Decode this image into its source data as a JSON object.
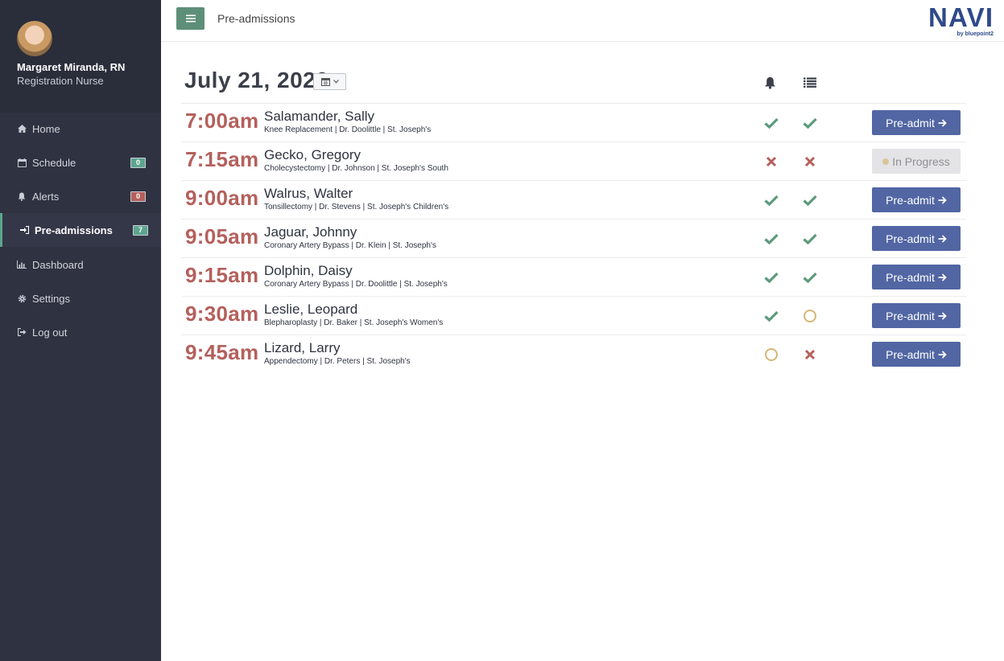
{
  "user": {
    "name": "Margaret Miranda, RN",
    "role": "Registration Nurse"
  },
  "nav": [
    {
      "label": "Home",
      "icon": "home-icon"
    },
    {
      "label": "Schedule",
      "icon": "calendar-icon",
      "badge": "0",
      "badge_color": "#5da58f"
    },
    {
      "label": "Alerts",
      "icon": "bell-icon",
      "badge": "0",
      "badge_color": "#b4605c"
    },
    {
      "label": "Pre-admissions",
      "icon": "sign-in-icon",
      "badge": "7",
      "badge_color": "#5da58f",
      "active": true
    },
    {
      "label": "Dashboard",
      "icon": "bar-chart-icon"
    },
    {
      "label": "Settings",
      "icon": "gear-icon"
    },
    {
      "label": "Log out",
      "icon": "log-out-icon"
    }
  ],
  "header": {
    "breadcrumb": "Pre-admissions",
    "logo_text": "NAVI",
    "logo_sub": "by bluepoint2"
  },
  "date": {
    "title": "July 21, 2020"
  },
  "colors": {
    "check": "#5d9a7c",
    "cross": "#b4605c",
    "pending": "#d6b676",
    "primary": "#5166a3",
    "time": "#b4605c"
  },
  "rows": [
    {
      "time": "7:00am",
      "name": "Salamander, Sally",
      "details": "Knee Replacement | Dr. Doolittle | St. Joseph's",
      "status1": "check",
      "status2": "check",
      "action": "Pre-admit",
      "action_state": "primary"
    },
    {
      "time": "7:15am",
      "name": "Gecko, Gregory",
      "details": "Cholecystectomy | Dr. Johnson | St. Joseph's South",
      "status1": "cross",
      "status2": "cross",
      "action": "In Progress",
      "action_state": "disabled"
    },
    {
      "time": "9:00am",
      "name": "Walrus, Walter",
      "details": "Tonsillectomy | Dr. Stevens | St. Joseph's Children's",
      "status1": "check",
      "status2": "check",
      "action": "Pre-admit",
      "action_state": "primary"
    },
    {
      "time": "9:05am",
      "name": "Jaguar, Johnny",
      "details": "Coronary Artery Bypass | Dr. Klein | St. Joseph's",
      "status1": "check",
      "status2": "check",
      "action": "Pre-admit",
      "action_state": "primary"
    },
    {
      "time": "9:15am",
      "name": "Dolphin, Daisy",
      "details": "Coronary Artery Bypass | Dr. Doolittle | St. Joseph's",
      "status1": "check",
      "status2": "check",
      "action": "Pre-admit",
      "action_state": "primary"
    },
    {
      "time": "9:30am",
      "name": "Leslie, Leopard",
      "details": "Blepharoplasty | Dr. Baker | St. Joseph's Women's",
      "status1": "check",
      "status2": "pending",
      "action": "Pre-admit",
      "action_state": "primary"
    },
    {
      "time": "9:45am",
      "name": "Lizard, Larry",
      "details": "Appendectomy | Dr. Peters | St. Joseph's",
      "status1": "pending",
      "status2": "cross",
      "action": "Pre-admit",
      "action_state": "primary"
    }
  ]
}
